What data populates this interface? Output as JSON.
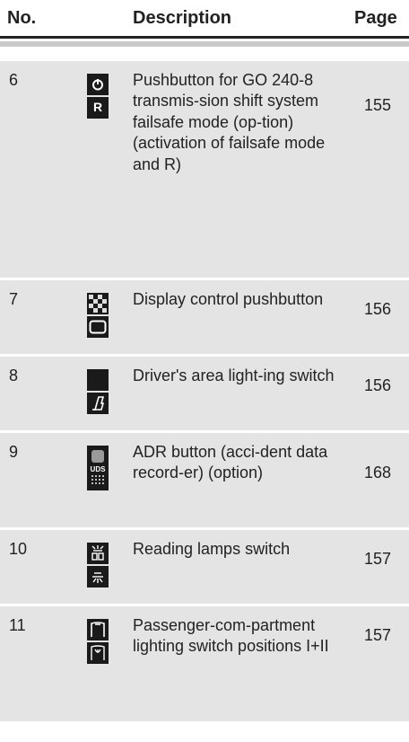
{
  "header": {
    "no": "No.",
    "description": "Description",
    "page": "Page"
  },
  "rows": [
    {
      "no": "6",
      "description": "Pushbutton for GO 240-8 transmis-sion shift system failsafe mode (op-tion) (activation of failsafe mode and R)",
      "page": "155",
      "icons": [
        "power-icon",
        "r-letter-icon"
      ],
      "icon_text": "R"
    },
    {
      "no": "7",
      "description": "Display control pushbutton",
      "page": "156",
      "icons": [
        "checker-icon",
        "display-frame-icon"
      ]
    },
    {
      "no": "8",
      "description": "Driver's area light-ing switch",
      "page": "156",
      "icons": [
        "blank-icon",
        "driver-seat-icon"
      ]
    },
    {
      "no": "9",
      "description": "ADR button (acci-dent data record-er) (option)",
      "page": "168",
      "icons": [
        "adr-button-icon"
      ],
      "icon_text": "UDS"
    },
    {
      "no": "10",
      "description": "Reading lamps switch",
      "page": "157",
      "icons": [
        "reading-lamp-icon",
        "lamp-icon"
      ]
    },
    {
      "no": "11",
      "description": "Passenger-com-partment lighting switch positions I+II",
      "page": "157",
      "icons": [
        "compartment-light-1-icon",
        "compartment-light-2-icon"
      ]
    }
  ]
}
